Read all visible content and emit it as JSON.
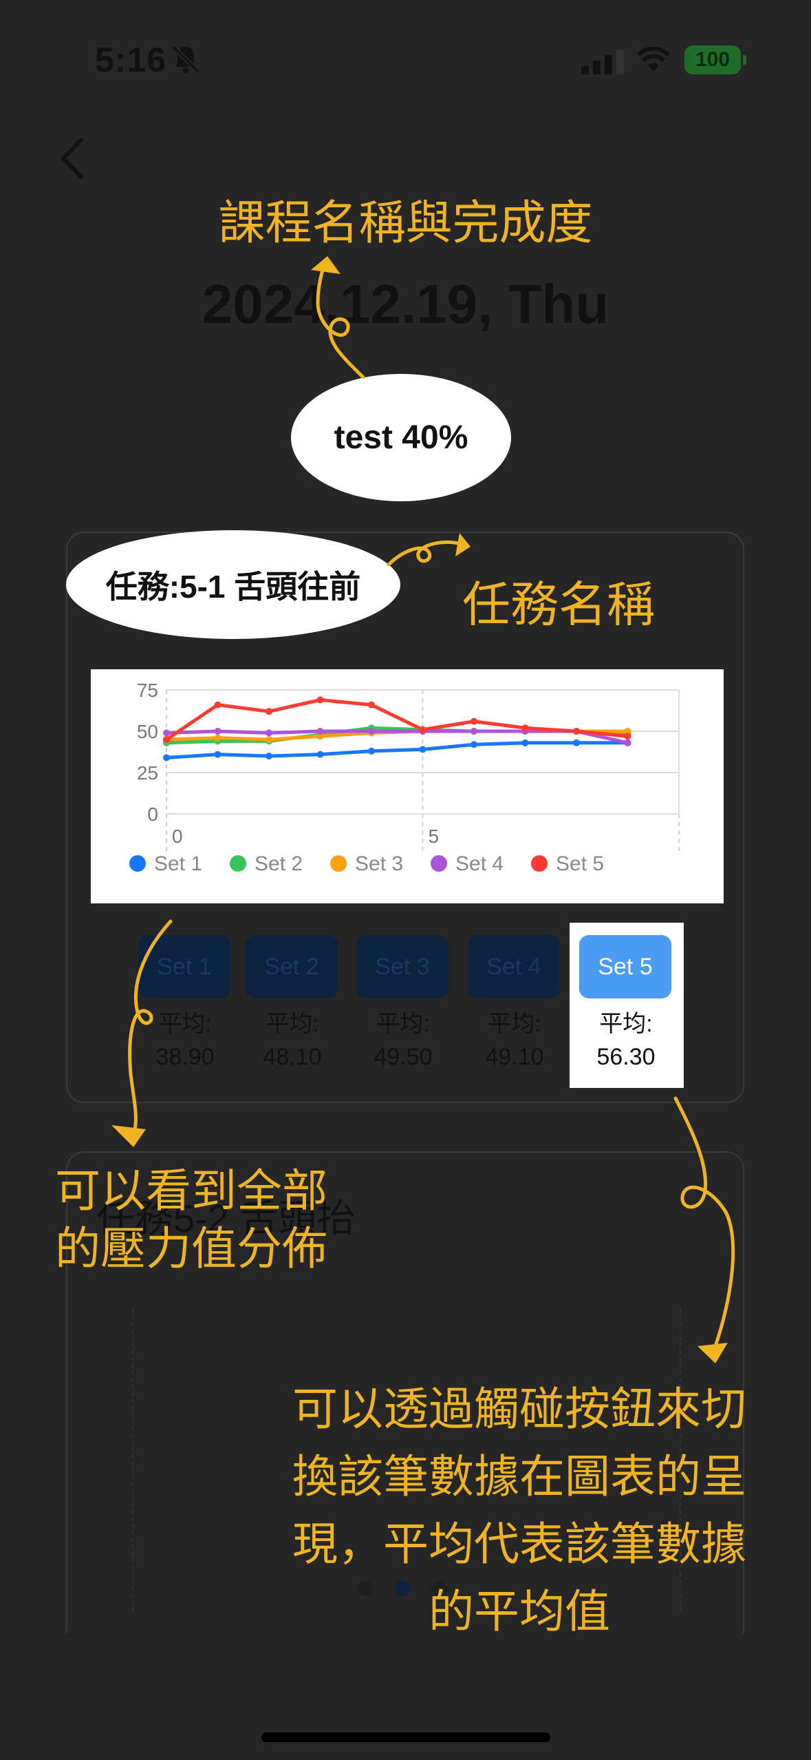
{
  "status_bar": {
    "time": "5:16",
    "battery": "100"
  },
  "annotations": {
    "course_title": "課程名稱與完成度",
    "task_name": "任務名稱",
    "see_all": [
      "可以看到全部",
      "的壓力值分佈"
    ],
    "touch_switch": [
      "可以透過觸碰按鈕來切",
      "換該筆數據在圖表的呈",
      "現，平均代表該筆數據",
      "的平均值"
    ]
  },
  "header": {
    "date": "2024.12.19, Thu"
  },
  "course": {
    "progress_label": "test 40%"
  },
  "task_card": {
    "title": "任務:5-1 舌頭往前",
    "set_buttons": [
      {
        "label": "Set 1",
        "avg_label": "平均:",
        "avg_value": "38.90"
      },
      {
        "label": "Set 2",
        "avg_label": "平均:",
        "avg_value": "48.10"
      },
      {
        "label": "Set 3",
        "avg_label": "平均:",
        "avg_value": "49.50"
      },
      {
        "label": "Set 4",
        "avg_label": "平均:",
        "avg_value": "49.10"
      },
      {
        "label": "Set 5",
        "avg_label": "平均:",
        "avg_value": "56.30"
      }
    ],
    "active_set": "Set 5"
  },
  "second_card_title": "任務5-2 舌頭抬",
  "pager": {
    "pages": 3,
    "active": 1
  },
  "colors": {
    "annotation": "#f0b41e",
    "active_button": "#4a9cf5",
    "inactive_button": "#0c2440"
  },
  "chart_data": {
    "type": "line",
    "x": [
      0,
      1,
      2,
      3,
      4,
      5,
      6,
      7,
      8,
      9
    ],
    "xticks": [
      0,
      5
    ],
    "yticks": [
      0,
      25,
      50,
      75
    ],
    "ylim": [
      0,
      75
    ],
    "xlim": [
      0,
      10
    ],
    "legend_position": "bottom",
    "series": [
      {
        "name": "Set 1",
        "color": "#1677ff",
        "values": [
          34,
          36,
          35,
          36,
          38,
          39,
          42,
          43,
          43,
          43
        ]
      },
      {
        "name": "Set 2",
        "color": "#34c759",
        "values": [
          43,
          44,
          44,
          48,
          52,
          51,
          50,
          50,
          50,
          49
        ]
      },
      {
        "name": "Set 3",
        "color": "#ff9f0a",
        "values": [
          45,
          46,
          45,
          47,
          49,
          50,
          50,
          50,
          50,
          50
        ]
      },
      {
        "name": "Set 4",
        "color": "#af52de",
        "values": [
          49,
          50,
          49,
          50,
          50,
          50,
          50,
          50,
          50,
          43
        ]
      },
      {
        "name": "Set 5",
        "color": "#ff3b30",
        "values": [
          45,
          66,
          62,
          69,
          66,
          51,
          56,
          52,
          50,
          47
        ]
      }
    ]
  }
}
